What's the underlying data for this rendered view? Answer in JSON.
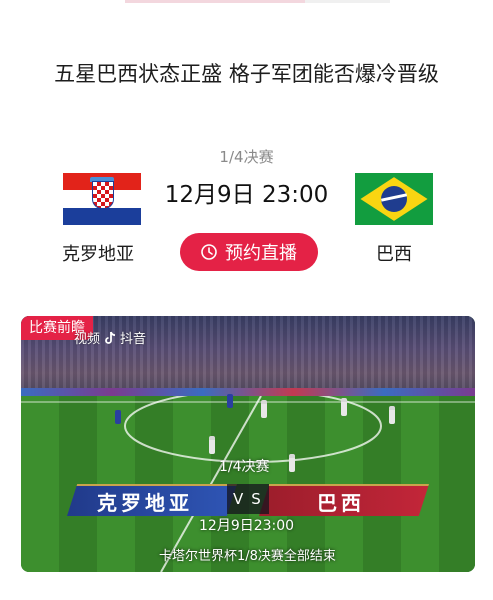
{
  "headline": "五星巴西状态正盛 格子军团能否爆冷晋级",
  "match": {
    "stage": "1/4决赛",
    "time": "12月9日 23:00",
    "team_left": "克罗地亚",
    "team_right": "巴西",
    "reserve_label": "预约直播"
  },
  "video": {
    "badge": "比赛前瞻",
    "watermark_prefix": "视频",
    "watermark_brand": "抖音",
    "overlay_stage": "1/4决赛",
    "overlay_team_left": "克罗地亚",
    "overlay_vs": "VS",
    "overlay_team_right": "巴西",
    "overlay_time": "12月9日23:00",
    "overlay_caption": "卡塔尔世界杯1/8决赛全部结束"
  },
  "colors": {
    "accent": "#e42246",
    "croatia_red": "#e2231a",
    "croatia_blue": "#1b3e9b",
    "brazil_green": "#129d3f",
    "brazil_yellow": "#f9d512",
    "brazil_blue": "#1f3d8f"
  },
  "icons": [
    "clock-icon",
    "tiktok-icon"
  ]
}
